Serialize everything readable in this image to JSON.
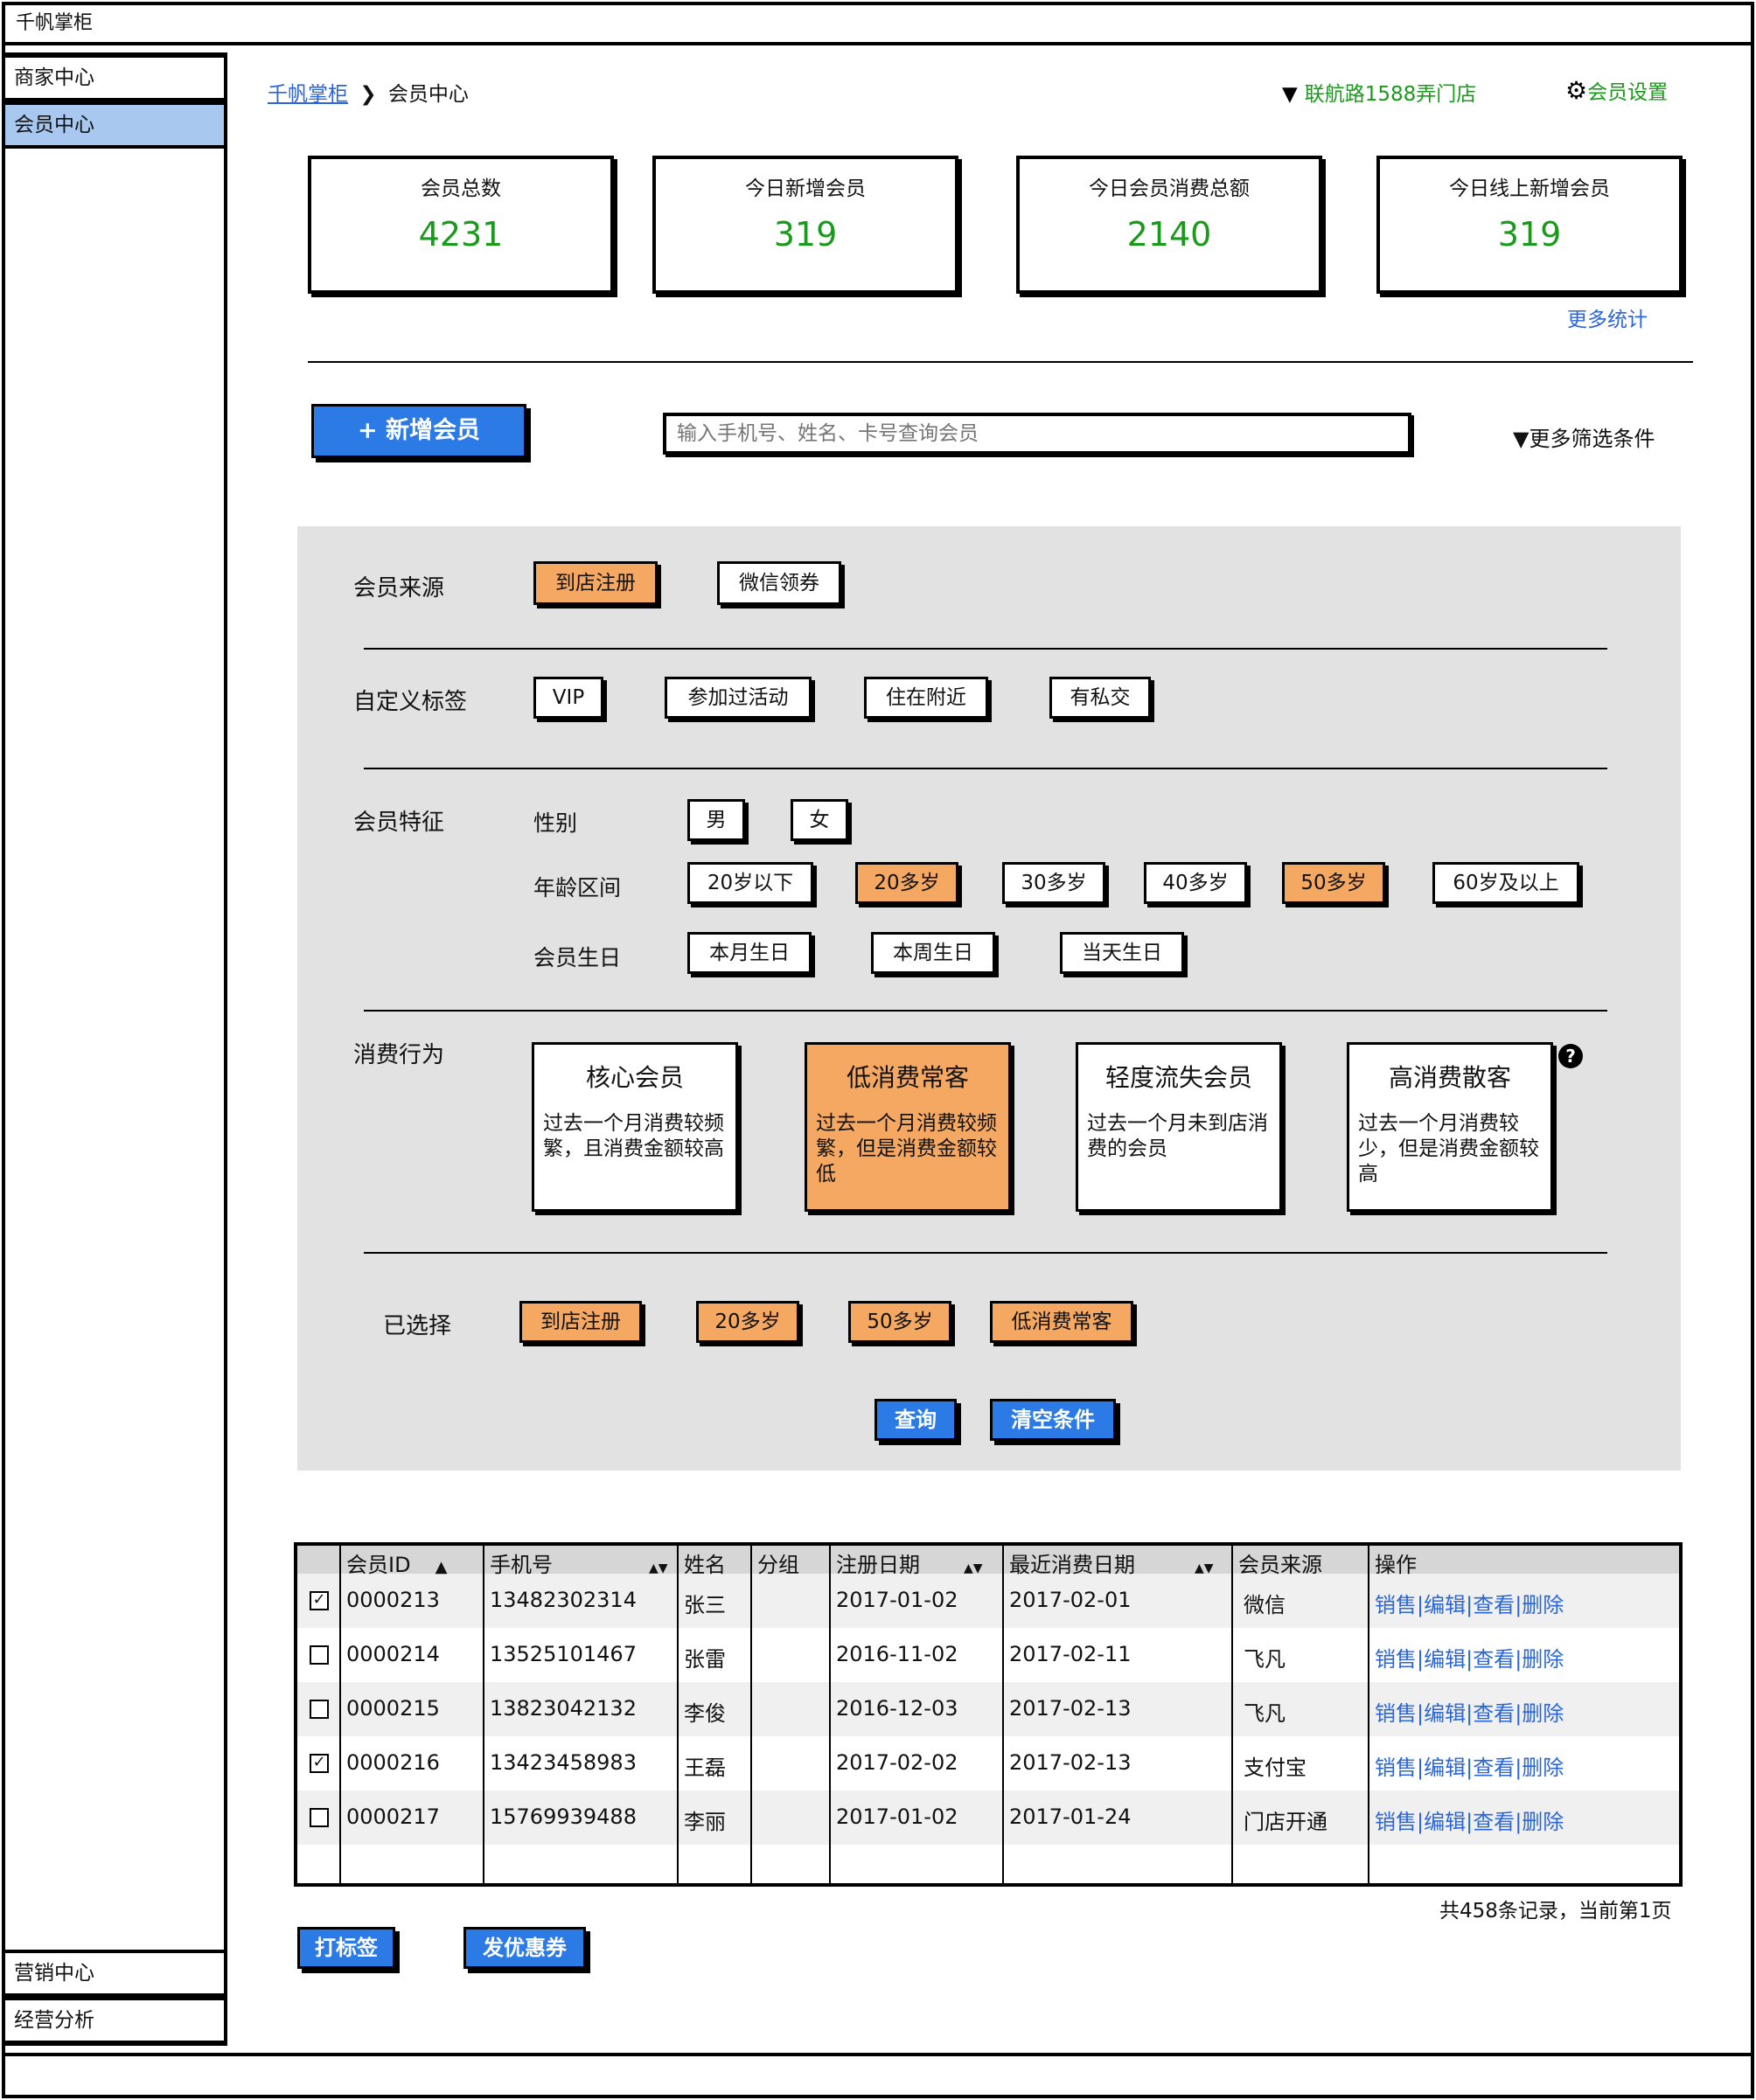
{
  "app_title": "千帆掌柜",
  "sidebar": {
    "top_items": [
      {
        "label": "商家中心"
      },
      {
        "label": "会员中心"
      }
    ],
    "bottom_items": [
      {
        "label": "营销中心"
      },
      {
        "label": "经营分析"
      }
    ]
  },
  "header": {
    "breadcrumb_root": "千帆掌柜",
    "breadcrumb_sep": "❯",
    "breadcrumb_current": "会员中心",
    "store_selector": "联航路1588弄门店",
    "settings_label": "会员设置"
  },
  "stats": [
    {
      "label": "会员总数",
      "value": "4231"
    },
    {
      "label": "今日新增会员",
      "value": "319"
    },
    {
      "label": "今日会员消费总额",
      "value": "2140"
    },
    {
      "label": "今日线上新增会员",
      "value": "319"
    }
  ],
  "more_stats": "更多统计",
  "toolbar": {
    "add_member": "+ 新增会员",
    "search_placeholder": "输入手机号、姓名、卡号查询会员",
    "more_filters": "更多筛选条件"
  },
  "filters": {
    "source_label": "会员来源",
    "source_chips": [
      "到店注册",
      "微信领券"
    ],
    "tags_label": "自定义标签",
    "tag_chips": [
      "VIP",
      "参加过活动",
      "住在附近",
      "有私交"
    ],
    "features_label": "会员特征",
    "gender_label": "性别",
    "gender_chips": [
      "男",
      "女"
    ],
    "age_label": "年龄区间",
    "age_chips": [
      "20岁以下",
      "20多岁",
      "30多岁",
      "40多岁",
      "50多岁",
      "60岁及以上"
    ],
    "birthday_label": "会员生日",
    "birthday_chips": [
      "本月生日",
      "本周生日",
      "当天生日"
    ],
    "behavior_label": "消费行为",
    "behavior_cards": [
      {
        "title": "核心会员",
        "desc": "过去一个月消费较频繁，且消费金额较高"
      },
      {
        "title": "低消费常客",
        "desc": "过去一个月消费较频繁，但是消费金额较低"
      },
      {
        "title": "轻度流失会员",
        "desc": "过去一个月未到店消费的会员"
      },
      {
        "title": "高消费散客",
        "desc": "过去一个月消费较少，但是消费金额较高"
      }
    ],
    "help_icon": "?",
    "selected_label": "已选择",
    "selected_chips": [
      "到店注册",
      "20多岁",
      "50多岁",
      "低消费常客"
    ],
    "query_button": "查询",
    "clear_button": "清空条件"
  },
  "table": {
    "columns": [
      "会员ID",
      "手机号",
      "姓名",
      "分组",
      "注册日期",
      "最近消费日期",
      "会员来源",
      "操作"
    ],
    "rows": [
      {
        "checked": true,
        "id": "0000213",
        "phone": "13482302314",
        "name": "张三",
        "group": "",
        "reg": "2017-01-02",
        "last": "2017-02-01",
        "source": "微信"
      },
      {
        "checked": false,
        "id": "0000214",
        "phone": "13525101467",
        "name": "张雷",
        "group": "",
        "reg": "2016-11-02",
        "last": "2017-02-11",
        "source": "飞凡"
      },
      {
        "checked": false,
        "id": "0000215",
        "phone": "13823042132",
        "name": "李俊",
        "group": "",
        "reg": "2016-12-03",
        "last": "2017-02-13",
        "source": "飞凡"
      },
      {
        "checked": true,
        "id": "0000216",
        "phone": "13423458983",
        "name": "王磊",
        "group": "",
        "reg": "2017-02-02",
        "last": "2017-02-13",
        "source": "支付宝"
      },
      {
        "checked": false,
        "id": "0000217",
        "phone": "15769939488",
        "name": "李丽",
        "group": "",
        "reg": "2017-01-02",
        "last": "2017-01-24",
        "source": "门店开通"
      }
    ],
    "ops": [
      "销售",
      "编辑",
      "查看",
      "删除"
    ],
    "ops_sep": "|",
    "pagination": "共458条记录，当前第1页"
  },
  "bulk_actions": {
    "tag_button": "打标签",
    "coupon_button": "发优惠券"
  },
  "colors": {
    "accent_blue": "#2b7ae6",
    "selected_orange": "#f4a862",
    "stat_green": "#1a9a1a",
    "panel_gray": "#e2e2e2",
    "nav_active": "#a8c8f0",
    "link_blue": "#2a66d9"
  }
}
